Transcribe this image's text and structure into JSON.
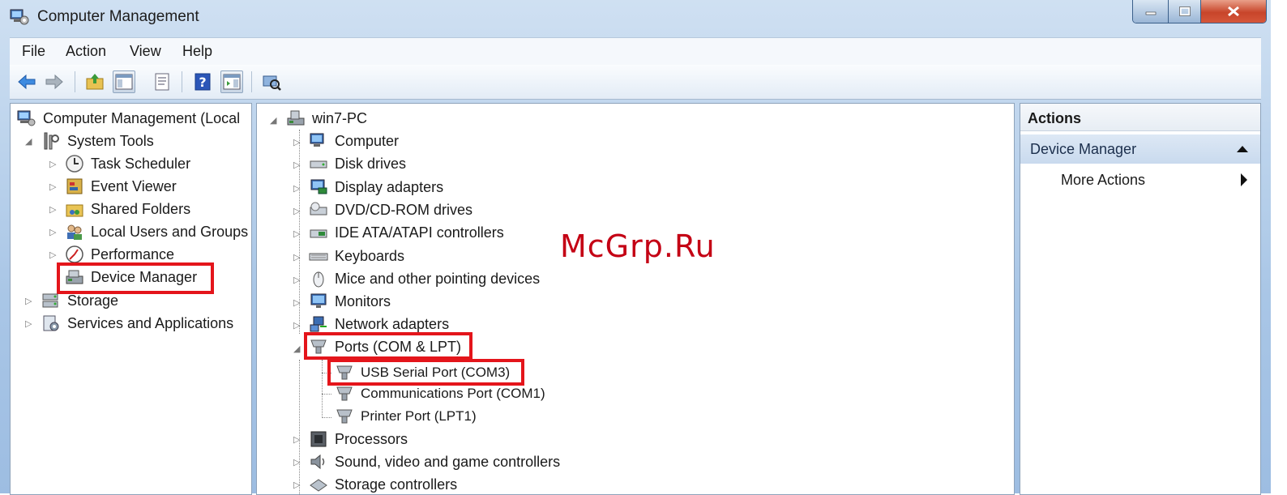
{
  "window": {
    "title": "Computer Management"
  },
  "menu": [
    "File",
    "Action",
    "View",
    "Help"
  ],
  "toolbar": {
    "icons": [
      "back-arrow-icon",
      "forward-arrow-icon",
      "up-folder-icon",
      "show-hide-console-tree-icon",
      "properties-icon",
      "help-icon",
      "show-hide-action-pane-icon",
      "scan-hardware-icon"
    ]
  },
  "left_tree": {
    "root": "Computer Management (Local",
    "system_tools": "System Tools",
    "task_scheduler": "Task Scheduler",
    "event_viewer": "Event Viewer",
    "shared_folders": "Shared Folders",
    "local_users": "Local Users and Groups",
    "performance": "Performance",
    "device_manager": "Device Manager",
    "storage": "Storage",
    "services": "Services and Applications"
  },
  "device_tree": {
    "root": "win7-PC",
    "categories": [
      "Computer",
      "Disk drives",
      "Display adapters",
      "DVD/CD-ROM drives",
      "IDE ATA/ATAPI controllers",
      "Keyboards",
      "Mice and other pointing devices",
      "Monitors",
      "Network adapters"
    ],
    "ports": "Ports (COM & LPT)",
    "port_children": [
      "USB Serial Port (COM3)",
      "Communications Port (COM1)",
      "Printer Port (LPT1)"
    ],
    "after_ports": [
      "Processors",
      "Sound, video and game controllers",
      "Storage controllers"
    ]
  },
  "actions": {
    "header": "Actions",
    "section": "Device Manager",
    "more": "More Actions"
  },
  "watermark": "McGrp.Ru",
  "colors": {
    "highlight": "#e4151b",
    "watermark": "#c40014"
  }
}
